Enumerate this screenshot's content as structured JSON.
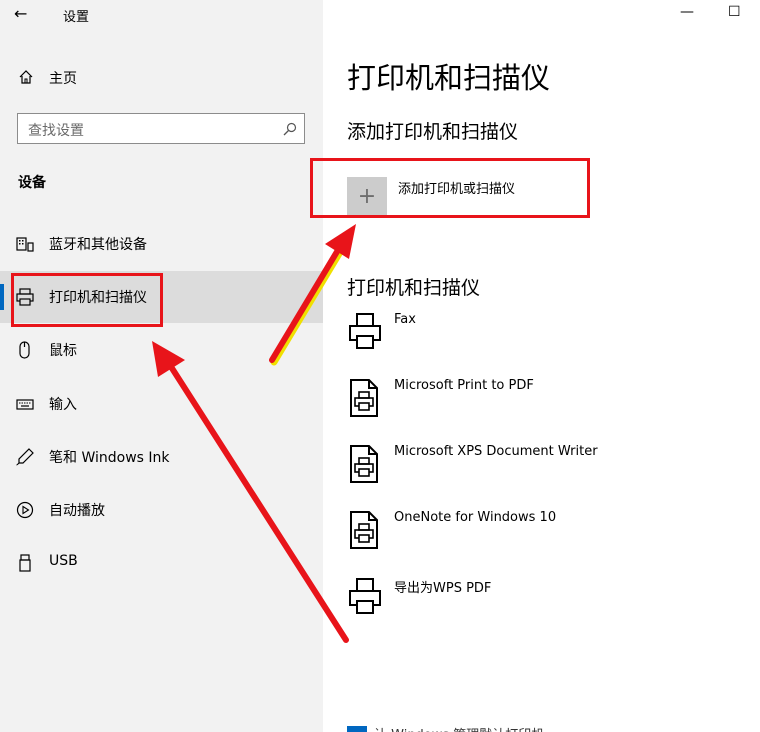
{
  "window": {
    "back_glyph": "←",
    "title": "设置",
    "minimize_glyph": "—",
    "maximize_glyph": "☐"
  },
  "sidebar": {
    "home_label": "主页",
    "search_placeholder": "查找设置",
    "section_header": "设备",
    "items": [
      {
        "label": "蓝牙和其他设备",
        "icon": "bluetooth-devices-icon"
      },
      {
        "label": "打印机和扫描仪",
        "icon": "printer-icon",
        "selected": true
      },
      {
        "label": "鼠标",
        "icon": "mouse-icon"
      },
      {
        "label": "输入",
        "icon": "keyboard-icon"
      },
      {
        "label": "笔和 Windows Ink",
        "icon": "pen-icon"
      },
      {
        "label": "自动播放",
        "icon": "autoplay-icon"
      },
      {
        "label": "USB",
        "icon": "usb-icon"
      }
    ]
  },
  "main": {
    "title": "打印机和扫描仪",
    "add_section_title": "添加打印机和扫描仪",
    "add_button_label": "添加打印机或扫描仪",
    "list_section_title": "打印机和扫描仪",
    "printers": [
      {
        "name": "Fax",
        "icon": "printer-icon"
      },
      {
        "name": "Microsoft Print to PDF",
        "icon": "document-printer-icon"
      },
      {
        "name": "Microsoft XPS Document Writer",
        "icon": "document-printer-icon"
      },
      {
        "name": "OneNote for Windows 10",
        "icon": "document-printer-icon"
      },
      {
        "name": "导出为WPS PDF",
        "icon": "printer-icon"
      }
    ],
    "bottom_text": "让 Windows 管理默认打印机"
  },
  "colors": {
    "annotation_red": "#e8141a",
    "accent_blue": "#0067c0",
    "sidebar_bg": "#f2f2f2"
  }
}
